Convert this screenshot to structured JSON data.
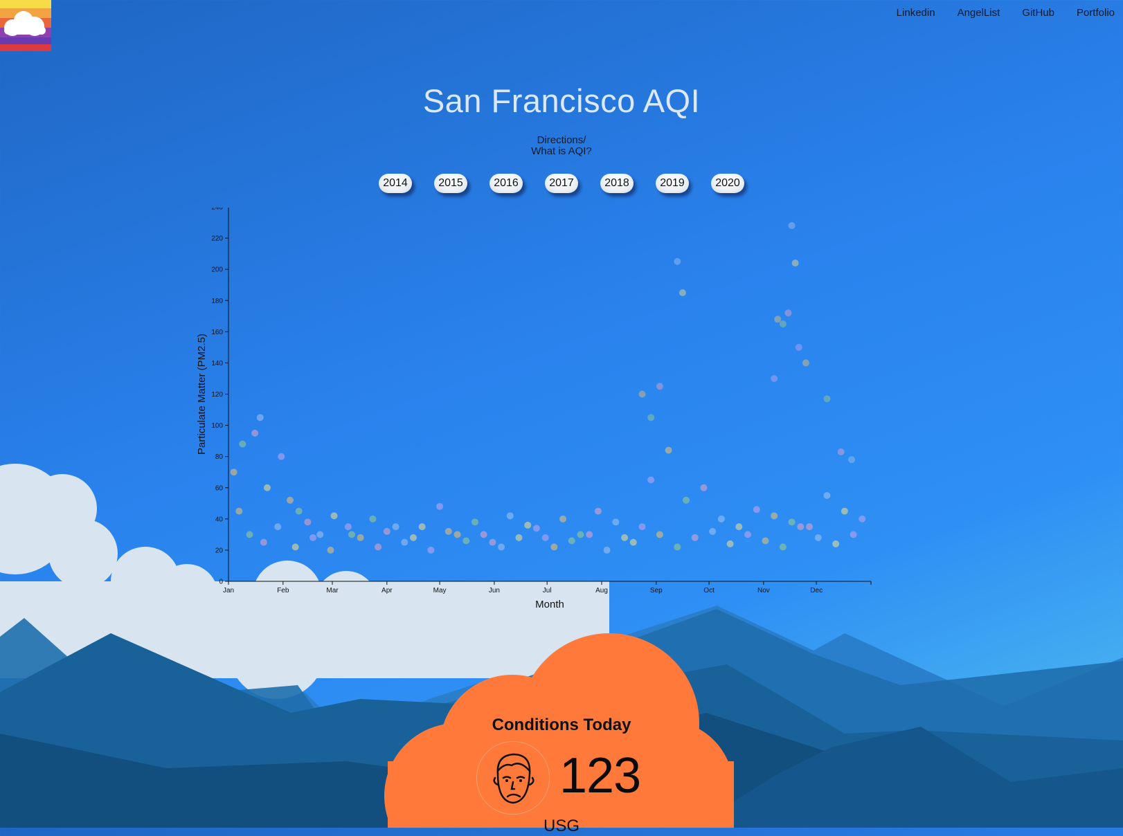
{
  "nav": {
    "links": [
      "Linkedin",
      "AngelList",
      "GitHub",
      "Portfolio"
    ]
  },
  "header": {
    "title": "San Francisco AQI",
    "directions_line1": "Directions/",
    "directions_line2": "What is AQI?"
  },
  "years": [
    "2014",
    "2015",
    "2016",
    "2017",
    "2018",
    "2019",
    "2020"
  ],
  "conditions": {
    "heading": "Conditions Today",
    "aqi_value": "123",
    "category": "USG",
    "face_icon": "sad-face-icon",
    "panel_color": "#ff7a3a"
  },
  "colors": {
    "sky": "#2a83ee",
    "cloud": "#d6e4f0",
    "mountain_dark": "#124e7e",
    "accent": "#ff7a3a"
  },
  "chart_data": {
    "type": "scatter",
    "title": "",
    "xlabel": "Month",
    "ylabel": "Particulate Matter (PM2.5)",
    "x_ticks": [
      "Jan",
      "Feb",
      "Mar",
      "Apr",
      "May",
      "Jun",
      "Jul",
      "Aug",
      "Sep",
      "Oct",
      "Nov",
      "Dec"
    ],
    "y_ticks": [
      0,
      20,
      40,
      60,
      80,
      100,
      120,
      140,
      160,
      180,
      200,
      220,
      240
    ],
    "xlim_days": [
      0,
      365
    ],
    "ylim": [
      0,
      240
    ],
    "series": [
      {
        "x": [
          3,
          8,
          15,
          18,
          22,
          30,
          35,
          40,
          45,
          52,
          60,
          68,
          75,
          82,
          90,
          100,
          110,
          120,
          130,
          140,
          150,
          160,
          170,
          180,
          190,
          200,
          210,
          220,
          230,
          240,
          250,
          260,
          270,
          280,
          290,
          300,
          310,
          320,
          330,
          340,
          350,
          360
        ],
        "y": [
          70,
          88,
          95,
          105,
          60,
          80,
          52,
          45,
          38,
          30,
          42,
          35,
          28,
          40,
          32,
          25,
          35,
          48,
          30,
          38,
          25,
          42,
          36,
          28,
          40,
          30,
          45,
          38,
          25,
          65,
          84,
          52,
          60,
          40,
          35,
          46,
          42,
          38,
          35,
          55,
          45,
          40
        ]
      },
      {
        "x": [
          6,
          12,
          20,
          28,
          38,
          48,
          58,
          70,
          85,
          95,
          105,
          115,
          125,
          135,
          145,
          155,
          165,
          175,
          185,
          195,
          205,
          215,
          225,
          235,
          245,
          255,
          265,
          275,
          285,
          295,
          305,
          315,
          325,
          335,
          345,
          355
        ],
        "y": [
          45,
          30,
          25,
          35,
          22,
          28,
          20,
          30,
          22,
          35,
          28,
          20,
          32,
          26,
          30,
          22,
          28,
          34,
          22,
          26,
          30,
          20,
          28,
          35,
          30,
          22,
          28,
          32,
          24,
          30,
          26,
          22,
          35,
          28,
          24,
          30
        ]
      },
      {
        "x": [
          235,
          240,
          245,
          255,
          258,
          310,
          312,
          315,
          318,
          320,
          322,
          324,
          328,
          340,
          348,
          354
        ],
        "y": [
          120,
          105,
          125,
          205,
          185,
          130,
          168,
          165,
          172,
          228,
          204,
          150,
          140,
          117,
          83,
          78
        ]
      }
    ]
  }
}
